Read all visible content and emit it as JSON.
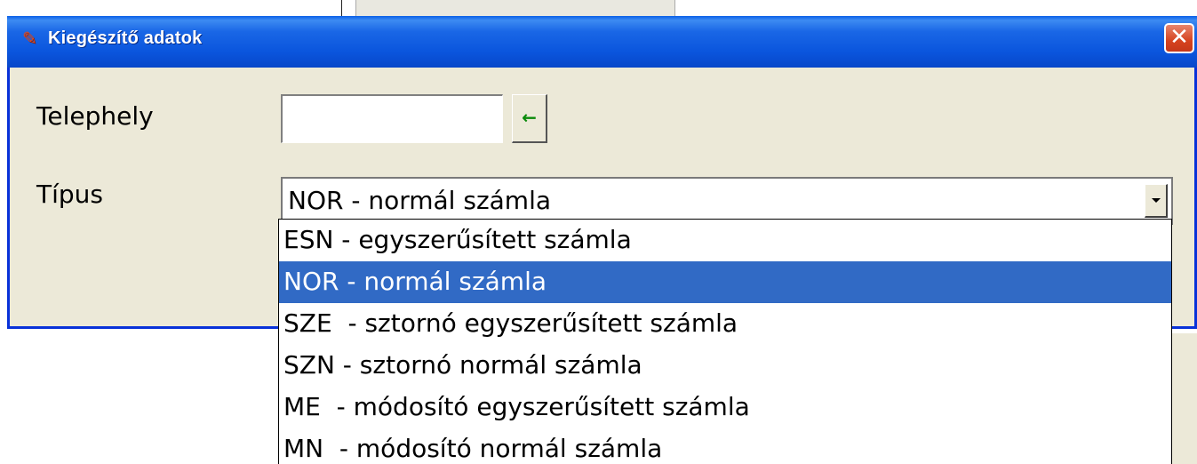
{
  "window": {
    "title": "Kiegészítő adatok",
    "close_symbol": "✕",
    "title_icon": "app-edit-icon"
  },
  "form": {
    "telephely_label": "Telephely",
    "telephely_value": "",
    "pick_button_symbol": "◆",
    "tipus_label": "Típus",
    "tipus_selected": "NOR - normál számla"
  },
  "dropdown": {
    "options": [
      "ESN - egyszerűsített számla",
      "NOR - normál számla",
      "SZE  - sztornó egyszerűsített számla",
      "SZN - sztornó normál számla",
      "ME  - módosító egyszerűsített számla",
      "MN  - módosító normál számla"
    ],
    "selected_index": 1
  },
  "colors": {
    "titlebar": "#0a55dd",
    "selection": "#316ac5",
    "dialog_bg": "#ece9d8"
  }
}
